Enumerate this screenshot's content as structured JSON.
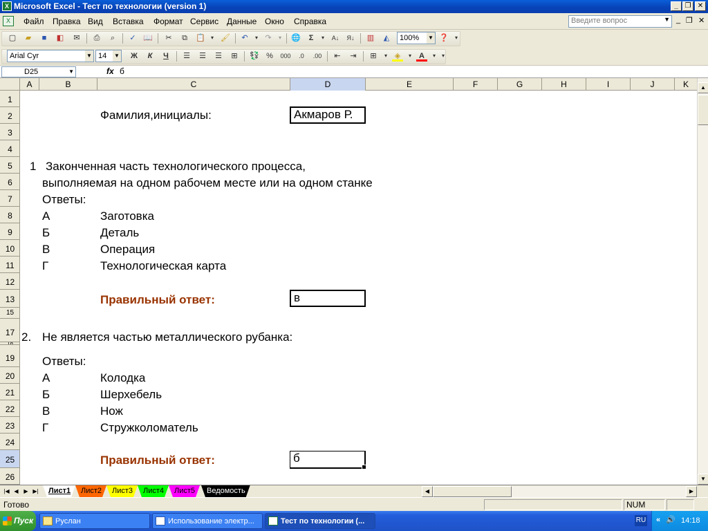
{
  "window": {
    "title": "Microsoft Excel - Тест по технологии (version 1)"
  },
  "menu": {
    "items": [
      "Файл",
      "Правка",
      "Вид",
      "Вставка",
      "Формат",
      "Сервис",
      "Данные",
      "Окно",
      "Справка"
    ],
    "question_placeholder": "Введите вопрос"
  },
  "toolbar": {
    "zoom": "100%",
    "font_name": "Arial Cyr",
    "font_size": "14",
    "bold": "Ж",
    "italic": "К",
    "underline": "Ч",
    "percent": "%",
    "thousands": "000",
    "sigma": "Σ",
    "font_color_label": "A"
  },
  "formula_bar": {
    "name_box": "D25",
    "fx": "fx",
    "value": "б"
  },
  "columns": [
    "A",
    "B",
    "C",
    "D",
    "E",
    "F",
    "G",
    "H",
    "I",
    "J",
    "K"
  ],
  "rows": [
    "1",
    "2",
    "3",
    "4",
    "5",
    "6",
    "7",
    "8",
    "9",
    "10",
    "11",
    "12",
    "13",
    "15",
    "17",
    "18",
    "19",
    "20",
    "21",
    "22",
    "23",
    "24",
    "25",
    "26"
  ],
  "sheet": {
    "name_label": "Фамилия,инициалы:",
    "name_value": "Акмаров Р.",
    "q1": {
      "number": "1",
      "line1": "Законченная часть технологического процесса,",
      "line2": "выполняемая на одном рабочем месте или на одном станке",
      "answers_label": "Ответы:",
      "options": [
        {
          "letter": "А",
          "text": "Заготовка"
        },
        {
          "letter": "Б",
          "text": "Деталь"
        },
        {
          "letter": "В",
          "text": "Операция"
        },
        {
          "letter": "Г",
          "text": "Технологическая карта"
        }
      ],
      "correct_label": "Правильный ответ:",
      "correct_value": "в"
    },
    "q2": {
      "number": "2.",
      "line1": "Не является частью металлического рубанка:",
      "answers_label": "Ответы:",
      "options": [
        {
          "letter": "А",
          "text": "Колодка"
        },
        {
          "letter": "Б",
          "text": "Шерхебель"
        },
        {
          "letter": "В",
          "text": "Нож"
        },
        {
          "letter": "Г",
          "text": "Стружколоматель"
        }
      ],
      "correct_label": "Правильный ответ:",
      "correct_value": "б"
    }
  },
  "sheet_tabs": [
    {
      "label": "Лист1",
      "color": "#ffffff"
    },
    {
      "label": "Лист2",
      "color": "#ff6600"
    },
    {
      "label": "Лист3",
      "color": "#ffff00"
    },
    {
      "label": "Лист4",
      "color": "#00ff00"
    },
    {
      "label": "Лист5",
      "color": "#ff00ff"
    },
    {
      "label": "Ведомость",
      "color": "#000000"
    }
  ],
  "status": {
    "ready": "Готово",
    "num": "NUM"
  },
  "taskbar": {
    "start": "Пуск",
    "tasks": [
      "Руслан",
      "Использование электр...",
      "Тест по технологии (..."
    ],
    "lang": "RU",
    "clock": "14:18"
  }
}
